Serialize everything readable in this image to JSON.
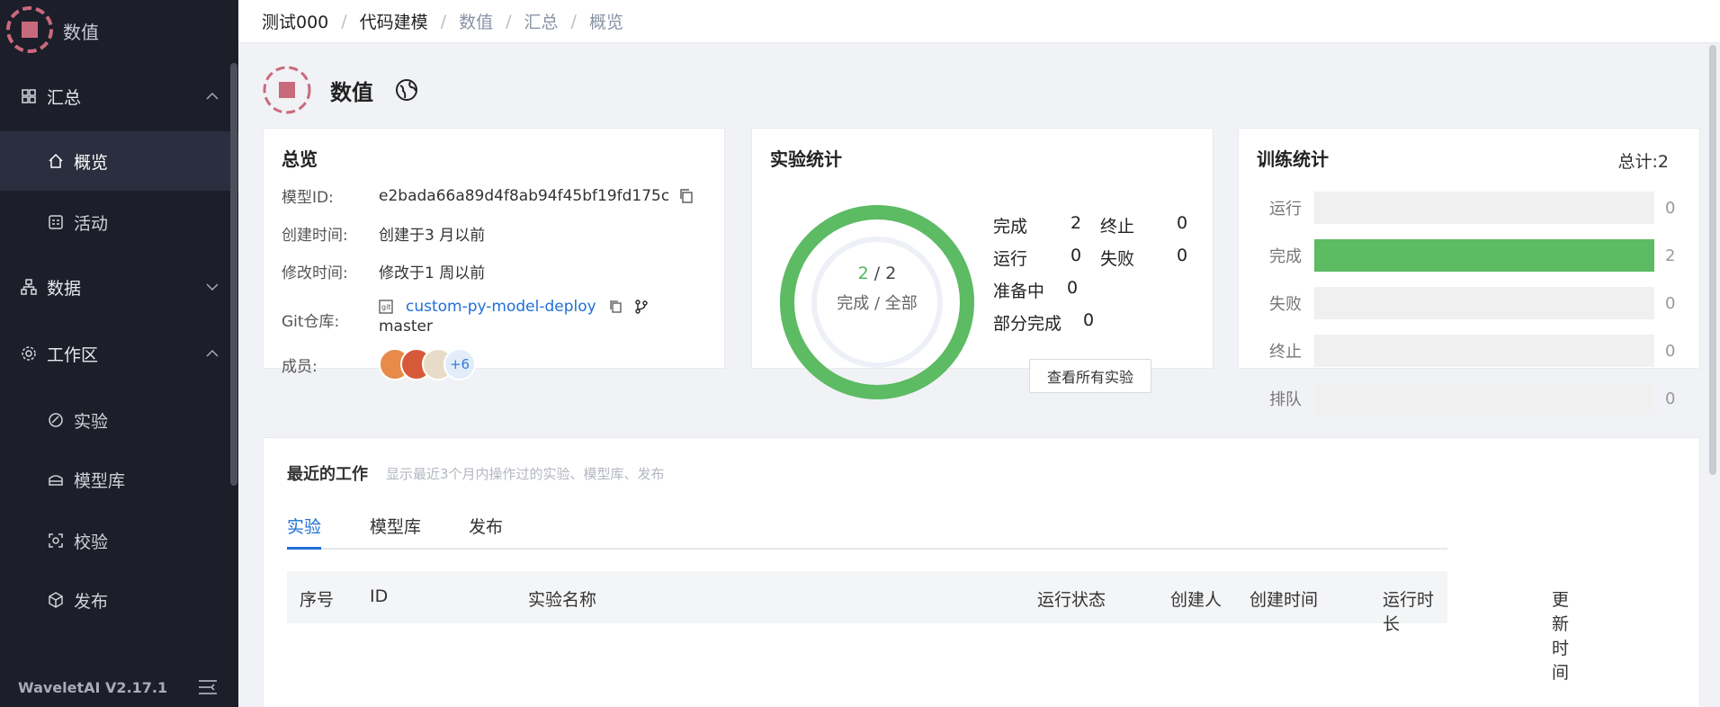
{
  "sidebar": {
    "title": "数值",
    "items": [
      {
        "label": "汇总"
      },
      {
        "label": "概览"
      },
      {
        "label": "活动"
      },
      {
        "label": "数据"
      },
      {
        "label": "工作区"
      },
      {
        "label": "实验"
      },
      {
        "label": "模型库"
      },
      {
        "label": "校验"
      },
      {
        "label": "发布"
      }
    ],
    "version": "WaveletAI V2.17.1"
  },
  "breadcrumb": [
    "测试000",
    "代码建模",
    "数值",
    "汇总",
    "概览"
  ],
  "header": {
    "name": "数值"
  },
  "overview": {
    "title": "总览",
    "model_id_label": "模型ID:",
    "model_id": "e2bada66a89d4f8ab94f45bf19fd175c",
    "created_label": "创建时间:",
    "created": "创建于3 月以前",
    "modified_label": "修改时间:",
    "modified": "修改于1 周以前",
    "git_label": "Git仓库:",
    "git_repo": "custom-py-model-deploy",
    "git_branch": "master",
    "members_label": "成员:",
    "members_more": "+6"
  },
  "experiment_stats": {
    "title": "实验统计",
    "done": "2",
    "total": "2",
    "caption": "完成 / 全部",
    "completion_fraction": 1.0,
    "rows": [
      {
        "label": "完成",
        "value": "2"
      },
      {
        "label": "终止",
        "value": "0"
      },
      {
        "label": "运行",
        "value": "0"
      },
      {
        "label": "失败",
        "value": "0"
      },
      {
        "label": "准备中",
        "value": "0"
      },
      {
        "label": "部分完成",
        "value": "0"
      }
    ],
    "view_all": "查看所有实验"
  },
  "training_stats": {
    "title": "训练统计",
    "total": "总计:2",
    "rows": [
      {
        "label": "运行",
        "value": "0",
        "fraction": 0
      },
      {
        "label": "完成",
        "value": "2",
        "fraction": 1
      },
      {
        "label": "失败",
        "value": "0",
        "fraction": 0
      },
      {
        "label": "终止",
        "value": "0",
        "fraction": 0
      },
      {
        "label": "排队",
        "value": "0",
        "fraction": 0
      }
    ]
  },
  "recent": {
    "title": "最近的工作",
    "subtitle": "显示最近3个月内操作过的实验、模型库、发布",
    "tabs": [
      "实验",
      "模型库",
      "发布"
    ],
    "columns": [
      "序号",
      "ID",
      "实验名称",
      "运行状态",
      "创建人",
      "创建时间",
      "运行时长",
      "更新时间"
    ]
  },
  "colors": {
    "accent": "#1e6fd9",
    "success": "#5cbb63",
    "sidebar_bg": "#1c1e29"
  }
}
